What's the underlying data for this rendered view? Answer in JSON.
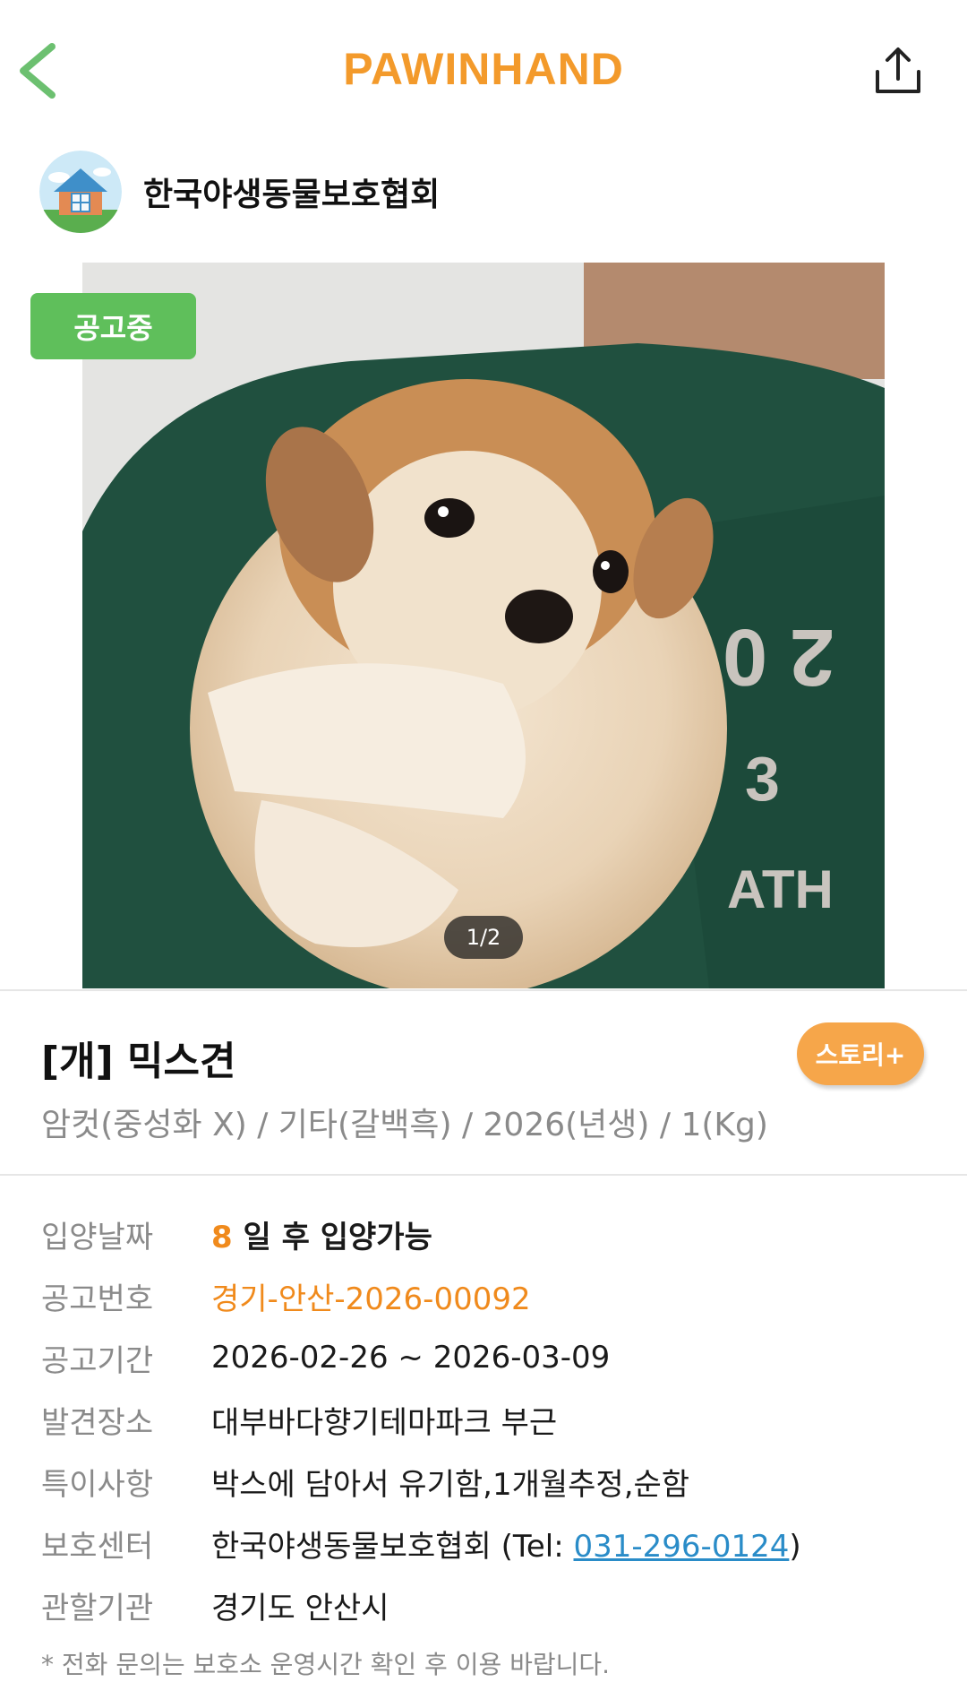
{
  "header": {
    "logo": "PAWINHAND",
    "back_icon": "chevron-left-icon",
    "share_icon": "share-icon"
  },
  "shelter": {
    "name": "한국야생동물보호협회"
  },
  "photo": {
    "status_badge": "공고중",
    "counter": "1/2"
  },
  "animal": {
    "title": "[개] 믹스견",
    "story_button": "스토리+",
    "summary": "암컷(중성화 X) / 기타(갈백흑) / 2026(년생) / 1(Kg)"
  },
  "info": {
    "adopt_date_label": "입양날짜",
    "adopt_days": "8",
    "adopt_text": " 일 후 입양가능",
    "notice_no_label": "공고번호",
    "notice_no": "경기-안산-2026-00092",
    "notice_period_label": "공고기간",
    "notice_period": "2026-02-26 ~ 2026-03-09",
    "found_place_label": "발견장소",
    "found_place": "대부바다향기테마파크 부근",
    "remarks_label": "특이사항",
    "remarks": "박스에 담아서 유기함,1개월추정,순함",
    "center_label": "보호센터",
    "center_name": "한국야생동물보호협회 (Tel: ",
    "center_tel": "031-296-0124",
    "center_close": ")",
    "authority_label": "관할기관",
    "authority": "경기도 안산시"
  },
  "footnote": "* 전화 문의는 보호소 운영시간 확인 후 이용 바랍니다.",
  "colors": {
    "brand_orange": "#F39A2B",
    "status_green": "#5FBF5B",
    "link_blue": "#2A8CC8",
    "back_green": "#6CC070"
  }
}
